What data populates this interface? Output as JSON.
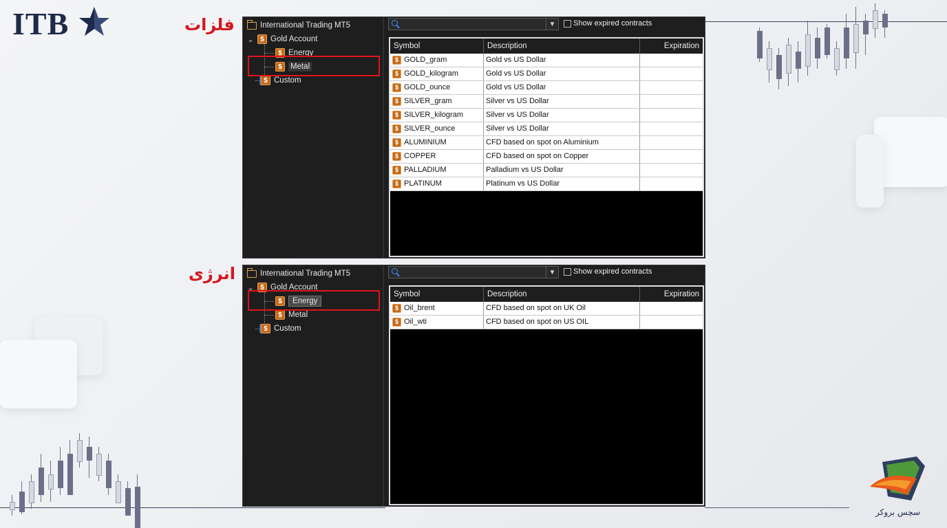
{
  "logo": {
    "text": "ITB"
  },
  "brand": {
    "text": "سچس بروکر"
  },
  "panels": [
    {
      "section_label": "فلزات",
      "tree": {
        "root": "International Trading MT5",
        "account": "Gold Account",
        "children": [
          "Energy",
          "Metal"
        ],
        "custom": "Custom",
        "selected": "Metal"
      },
      "search_placeholder": "",
      "show_expired_label": "Show expired contracts",
      "columns": [
        "Symbol",
        "Description",
        "Expiration"
      ],
      "rows": [
        {
          "symbol": "GOLD_gram",
          "description": "Gold vs US Dollar",
          "expiration": ""
        },
        {
          "symbol": "GOLD_kilogram",
          "description": "Gold vs US Dollar",
          "expiration": ""
        },
        {
          "symbol": "GOLD_ounce",
          "description": "Gold vs US Dollar",
          "expiration": ""
        },
        {
          "symbol": "SILVER_gram",
          "description": "Silver vs US Dollar",
          "expiration": ""
        },
        {
          "symbol": "SILVER_kilogram",
          "description": "Silver vs US Dollar",
          "expiration": ""
        },
        {
          "symbol": "SILVER_ounce",
          "description": "Silver vs US Dollar",
          "expiration": ""
        },
        {
          "symbol": "ALUMINIUM",
          "description": "CFD based on spot on Aluminium",
          "expiration": ""
        },
        {
          "symbol": "COPPER",
          "description": "CFD based on spot on Copper",
          "expiration": ""
        },
        {
          "symbol": "PALLADIUM",
          "description": "Palladium vs US Dollar",
          "expiration": ""
        },
        {
          "symbol": "PLATINUM",
          "description": "Platinum vs US Dollar",
          "expiration": ""
        }
      ]
    },
    {
      "section_label": "انرژی",
      "tree": {
        "root": "International Trading MT5",
        "account": "Gold Account",
        "children": [
          "Energy",
          "Metal"
        ],
        "custom": "Custom",
        "selected": "Energy"
      },
      "search_placeholder": "",
      "show_expired_label": "Show expired contracts",
      "columns": [
        "Symbol",
        "Description",
        "Expiration"
      ],
      "rows": [
        {
          "symbol": "Oil_brent",
          "description": "CFD based on spot on UK Oil",
          "expiration": ""
        },
        {
          "symbol": "Oil_wti",
          "description": "CFD based on spot on US OIL",
          "expiration": ""
        }
      ]
    }
  ],
  "colors": {
    "highlight": "#e0141b",
    "label": "#d6161c",
    "panel_bg": "#1e1e1e",
    "icon": "#c46a18"
  },
  "icons": {
    "currency": "$"
  }
}
